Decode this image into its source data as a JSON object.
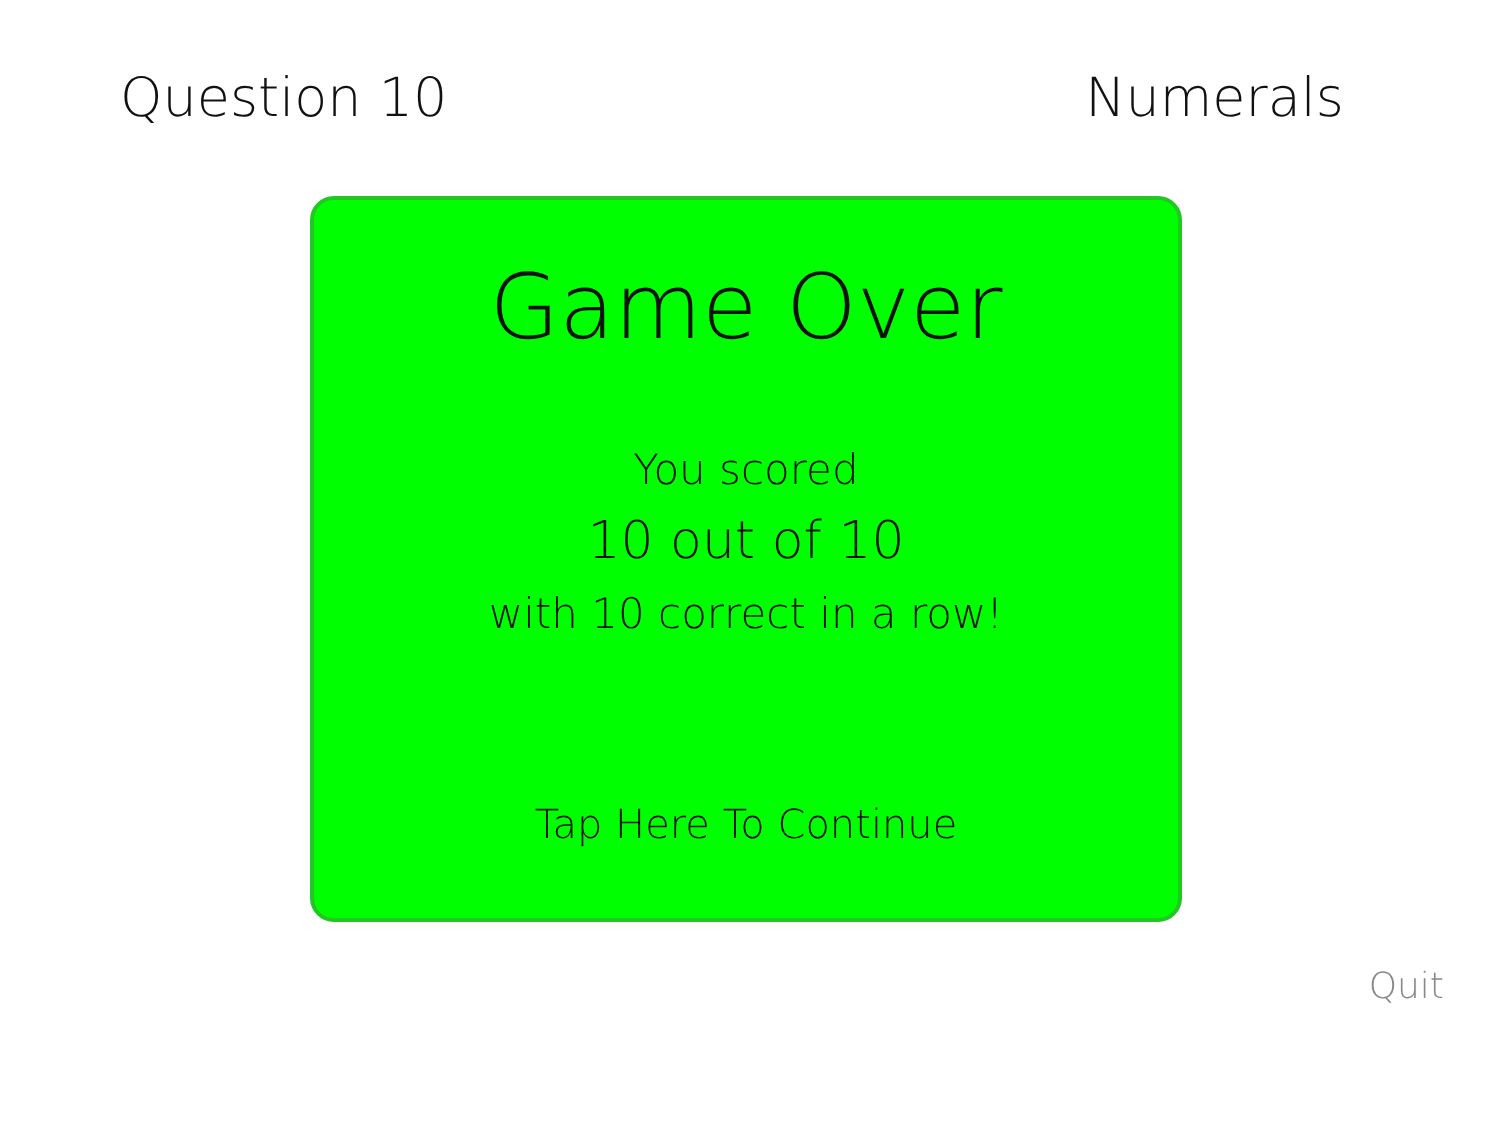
{
  "header": {
    "question": "Question 10",
    "category": "Numerals"
  },
  "result_card": {
    "title": "Game Over",
    "lines": [
      "You scored",
      "10 out of 10",
      "with 10 correct in a row!"
    ],
    "action": "Tap Here To Continue"
  },
  "footer": {
    "quit": "Quit"
  }
}
